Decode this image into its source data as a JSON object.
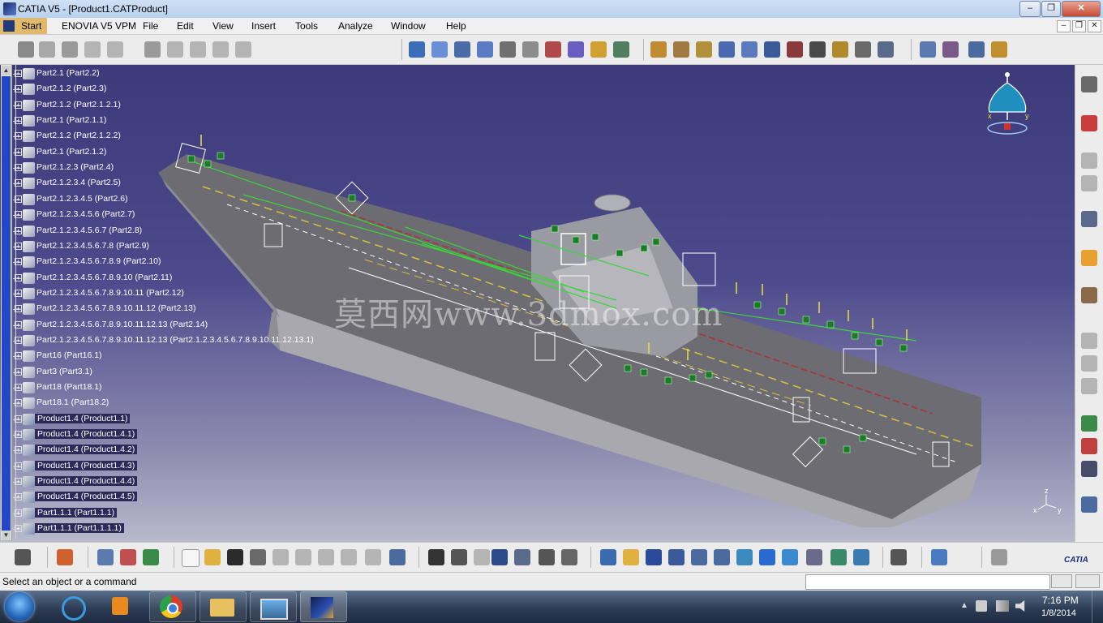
{
  "window": {
    "title": "CATIA V5 - [Product1.CATProduct]",
    "minimize": "–",
    "maximize": "❐",
    "close": "✕"
  },
  "menu": {
    "start": "Start",
    "items": [
      "ENOVIA V5 VPM",
      "File",
      "Edit",
      "View",
      "Insert",
      "Tools",
      "Analyze",
      "Window",
      "Help"
    ]
  },
  "tree": {
    "items": [
      {
        "label": "Part2.1 (Part2.2)",
        "hl": false
      },
      {
        "label": "Part2.1.2 (Part2.3)",
        "hl": false
      },
      {
        "label": "Part2.1.2 (Part2.1.2.1)",
        "hl": false
      },
      {
        "label": "Part2.1 (Part2.1.1)",
        "hl": false
      },
      {
        "label": "Part2.1.2 (Part2.1.2.2)",
        "hl": false
      },
      {
        "label": "Part2.1 (Part2.1.2)",
        "hl": false
      },
      {
        "label": "Part2.1.2.3 (Part2.4)",
        "hl": false
      },
      {
        "label": "Part2.1.2.3.4 (Part2.5)",
        "hl": false
      },
      {
        "label": "Part2.1.2.3.4.5 (Part2.6)",
        "hl": false
      },
      {
        "label": "Part2.1.2.3.4.5.6 (Part2.7)",
        "hl": false
      },
      {
        "label": "Part2.1.2.3.4.5.6.7 (Part2.8)",
        "hl": false
      },
      {
        "label": "Part2.1.2.3.4.5.6.7.8 (Part2.9)",
        "hl": false
      },
      {
        "label": "Part2.1.2.3.4.5.6.7.8.9 (Part2.10)",
        "hl": false
      },
      {
        "label": "Part2.1.2.3.4.5.6.7.8.9.10 (Part2.11)",
        "hl": false
      },
      {
        "label": "Part2.1.2.3.4.5.6.7.8.9.10.11 (Part2.12)",
        "hl": false
      },
      {
        "label": "Part2.1.2.3.4.5.6.7.8.9.10.11.12 (Part2.13)",
        "hl": false
      },
      {
        "label": "Part2.1.2.3.4.5.6.7.8.9.10.11.12.13 (Part2.14)",
        "hl": false
      },
      {
        "label": "Part2.1.2.3.4.5.6.7.8.9.10.11.12.13 (Part2.1.2.3.4.5.6.7.8.9.10.11.12.13.1)",
        "hl": false
      },
      {
        "label": "Part16 (Part16.1)",
        "hl": false
      },
      {
        "label": "Part3 (Part3.1)",
        "hl": false
      },
      {
        "label": "Part18 (Part18.1)",
        "hl": false
      },
      {
        "label": "Part18.1 (Part18.2)",
        "hl": false
      },
      {
        "label": "Product1.4 (Product1.1)",
        "hl": true
      },
      {
        "label": "Product1.4 (Product1.4.1)",
        "hl": true
      },
      {
        "label": "Product1.4 (Product1.4.2)",
        "hl": true
      },
      {
        "label": "Product1.4 (Product1.4.3)",
        "hl": true
      },
      {
        "label": "Product1.4 (Product1.4.4)",
        "hl": true
      },
      {
        "label": "Product1.4 (Product1.4.5)",
        "hl": true
      },
      {
        "label": "Part1.1.1 (Part1.1.1)",
        "hl": true
      },
      {
        "label": "Part1.1.1 (Part1.1.1.1)",
        "hl": true
      }
    ]
  },
  "viewport": {
    "watermark": "莫西网www.3dmox.com",
    "compass": {
      "x": "x",
      "y": "y"
    },
    "axis": {
      "x": "x",
      "y": "y",
      "z": "z"
    }
  },
  "brand": "CATIA",
  "status": {
    "text": "Select an object or a command",
    "command_value": ""
  },
  "taskbar": {
    "time": "7:16 PM",
    "date": "1/8/2014"
  },
  "colors": {
    "accent_start": "#e1b96b",
    "tree_highlight": "#2b2a58",
    "scroll_thumb": "#2646c8"
  }
}
